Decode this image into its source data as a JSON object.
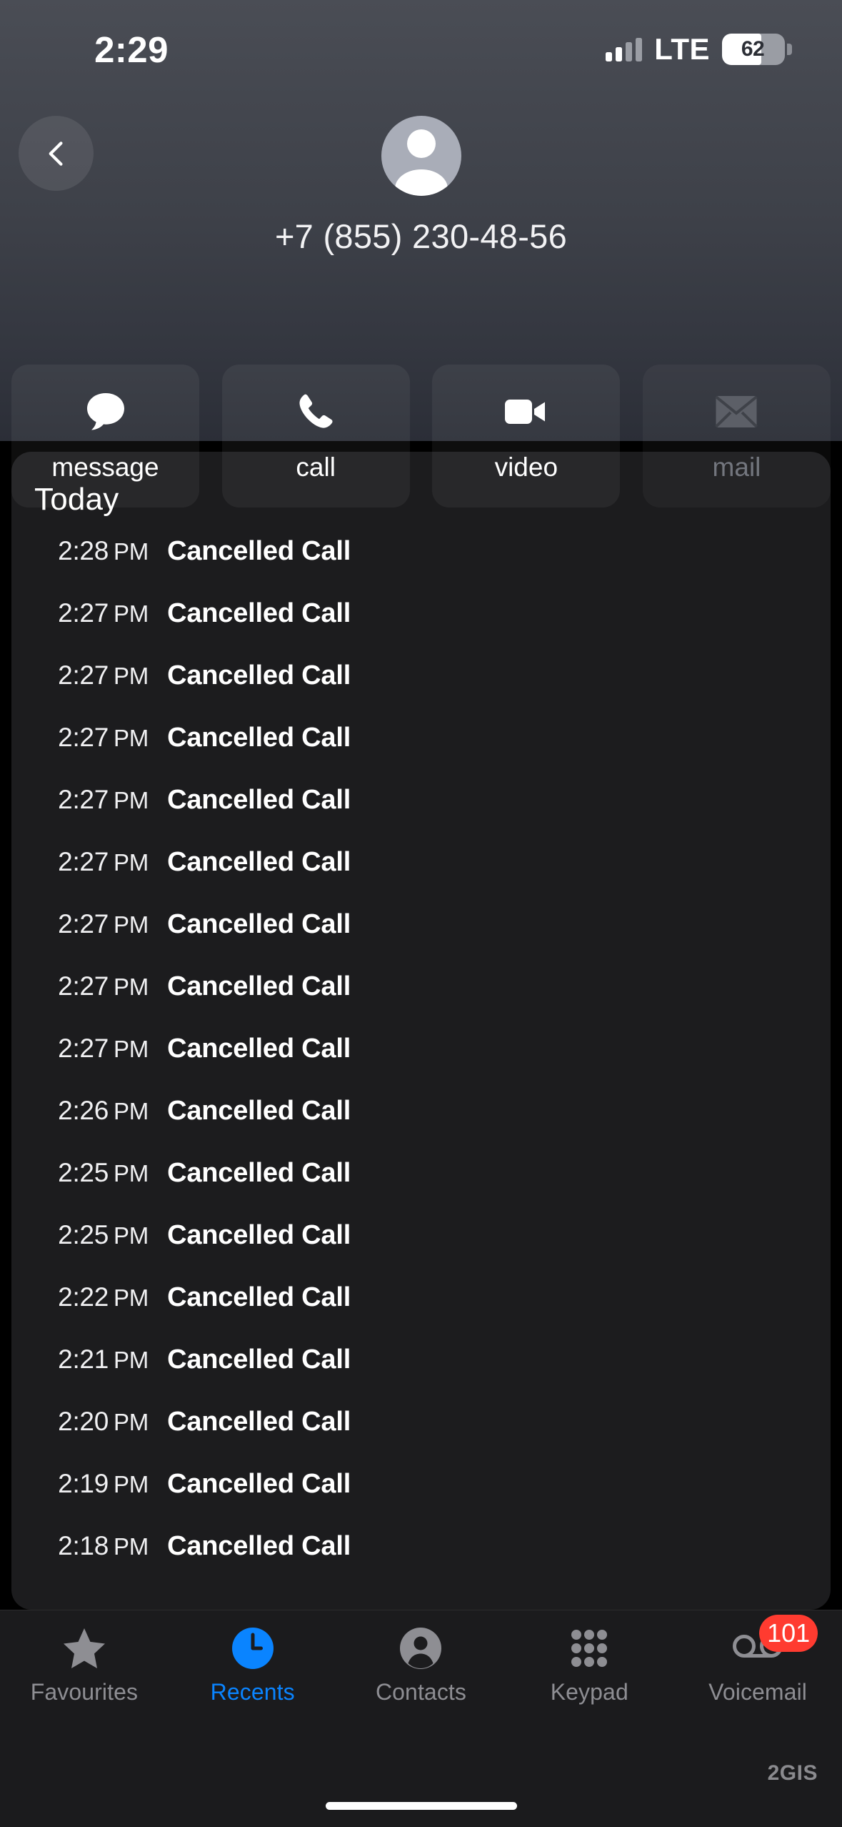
{
  "status_bar": {
    "time": "2:29",
    "network": "LTE",
    "battery_percent": "62",
    "signal_bars_total": 4,
    "signal_bars_filled": 2
  },
  "header": {
    "back_label": "Back",
    "avatar_icon": "person-avatar-icon",
    "phone_number": "+7 (855) 230-48-56",
    "actions": [
      {
        "label": "message",
        "icon": "message-bubble-icon",
        "disabled": false
      },
      {
        "label": "call",
        "icon": "phone-handset-icon",
        "disabled": false
      },
      {
        "label": "video",
        "icon": "video-camera-icon",
        "disabled": false
      },
      {
        "label": "mail",
        "icon": "envelope-icon",
        "disabled": true
      }
    ]
  },
  "call_list": {
    "day_header": "Today",
    "entries": [
      {
        "time": "2:28",
        "ampm": "PM",
        "label": "Cancelled Call"
      },
      {
        "time": "2:27",
        "ampm": "PM",
        "label": "Cancelled Call"
      },
      {
        "time": "2:27",
        "ampm": "PM",
        "label": "Cancelled Call"
      },
      {
        "time": "2:27",
        "ampm": "PM",
        "label": "Cancelled Call"
      },
      {
        "time": "2:27",
        "ampm": "PM",
        "label": "Cancelled Call"
      },
      {
        "time": "2:27",
        "ampm": "PM",
        "label": "Cancelled Call"
      },
      {
        "time": "2:27",
        "ampm": "PM",
        "label": "Cancelled Call"
      },
      {
        "time": "2:27",
        "ampm": "PM",
        "label": "Cancelled Call"
      },
      {
        "time": "2:27",
        "ampm": "PM",
        "label": "Cancelled Call"
      },
      {
        "time": "2:26",
        "ampm": "PM",
        "label": "Cancelled Call"
      },
      {
        "time": "2:25",
        "ampm": "PM",
        "label": "Cancelled Call"
      },
      {
        "time": "2:25",
        "ampm": "PM",
        "label": "Cancelled Call"
      },
      {
        "time": "2:22",
        "ampm": "PM",
        "label": "Cancelled Call"
      },
      {
        "time": "2:21",
        "ampm": "PM",
        "label": "Cancelled Call"
      },
      {
        "time": "2:20",
        "ampm": "PM",
        "label": "Cancelled Call"
      },
      {
        "time": "2:19",
        "ampm": "PM",
        "label": "Cancelled Call"
      },
      {
        "time": "2:18",
        "ampm": "PM",
        "label": "Cancelled Call"
      }
    ]
  },
  "tab_bar": {
    "active_tab": "Recents",
    "tabs": [
      {
        "label": "Favourites",
        "icon": "star-icon",
        "badge": ""
      },
      {
        "label": "Recents",
        "icon": "clock-icon",
        "badge": ""
      },
      {
        "label": "Contacts",
        "icon": "person-icon",
        "badge": ""
      },
      {
        "label": "Keypad",
        "icon": "keypad-dots-icon",
        "badge": ""
      },
      {
        "label": "Voicemail",
        "icon": "voicemail-tape-icon",
        "badge": "101"
      }
    ]
  },
  "watermark": "2GIS",
  "colors": {
    "accent_blue": "#0a84ff",
    "badge_red": "#ff3b30",
    "card_bg": "#1c1c1e",
    "header_top": "#4a4d55",
    "inactive_gray": "#8e8e93"
  }
}
